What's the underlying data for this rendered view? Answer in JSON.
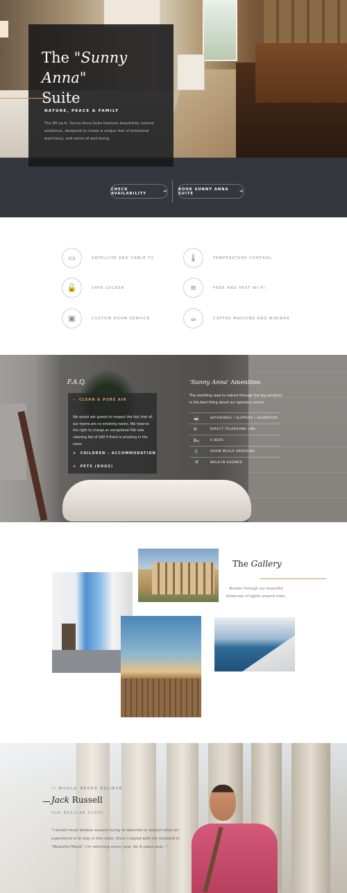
{
  "hero": {
    "title_prefix": "The",
    "title_italic": "\"Sunny Anna\"",
    "title_suffix": "Suite",
    "subtitle": "NATURE, PEACE & FAMILY",
    "description": "The 80 sq.m. Sunny Anna Suite features beautifully rustical ambiance, designed to create a unique feel of emotional warmness, and sense of well being."
  },
  "booking": {
    "check_label": "CHECK AVAILABILITY",
    "book_label": "BOOK SUNNY ANNA SUITE",
    "arrow": "➜"
  },
  "features": [
    {
      "icon": "tv-icon",
      "glyph": "▭",
      "label": "SATELLITE AND CABLE TV"
    },
    {
      "icon": "thermometer-icon",
      "glyph": "🌡",
      "label": "TEMPERATURE CONTROL"
    },
    {
      "icon": "lock-icon",
      "glyph": "🔓",
      "label": "SAFE LOCKER"
    },
    {
      "icon": "wifi-icon",
      "glyph": "≋",
      "label": "FREE AND FAST WI-FI"
    },
    {
      "icon": "suitcase-icon",
      "glyph": "▣",
      "label": "CUSTOM ROOM SERVICE"
    },
    {
      "icon": "coffee-icon",
      "glyph": "☕",
      "label": "COFFEE MACHINE AND MINIBAR"
    }
  ],
  "faq": {
    "title": "F.A.Q.",
    "items": [
      {
        "marker": "–",
        "label": "CLEAN & PURE AIR",
        "expanded": true
      },
      {
        "marker": "+",
        "label": "CHILDREN - ACCOMMODATION",
        "expanded": false
      },
      {
        "marker": "+",
        "label": "PETS (DOGS)",
        "expanded": false
      }
    ],
    "answer": "We would ask guests to respect the fact that all our rooms are no-smoking rooms. We reserve the right to charge an exceptional flat rate cleaning fee of $90 if there is smoking in the room."
  },
  "amenities": {
    "title_italic": "'Sunny Anna'",
    "title_suffix": "Amenities",
    "description": "The soothing view to nature through the big windows is the best thing about our spacious rooms.",
    "items": [
      {
        "icon": "bath-icon",
        "glyph": "🛁",
        "label": "BATHROBES / SLIPPERS / HAIRDRYER"
      },
      {
        "icon": "phone-icon",
        "glyph": "✆",
        "label": "DIRECT TELEPHONE LINE"
      },
      {
        "icon": "bed-icon",
        "glyph": "🛏",
        "label": "4 BEDS"
      },
      {
        "icon": "meal-icon",
        "glyph": "🍴",
        "label": "ROOM MEALS ORDERING"
      },
      {
        "icon": "shower-icon",
        "glyph": "🚿",
        "label": "WALK-IN SHOWER"
      }
    ]
  },
  "gallery": {
    "title_prefix": "The",
    "title_italic": "Gallery",
    "description": "Browse through our beautiful showcase of sights around town."
  },
  "testimonial": {
    "kicker": "\"I WOULD NEVER BELIEVE",
    "name_italic": "Jack",
    "name_rest": "Russell",
    "role": "OUR REGULAR GUEST",
    "quote": "\"I would never believe anyone trying to describe or explain what an experience is to stay in this suite. Once I stayed with my husband in \"Beautiful Maria\", I'm returning every year, for 6 years now...\""
  }
}
